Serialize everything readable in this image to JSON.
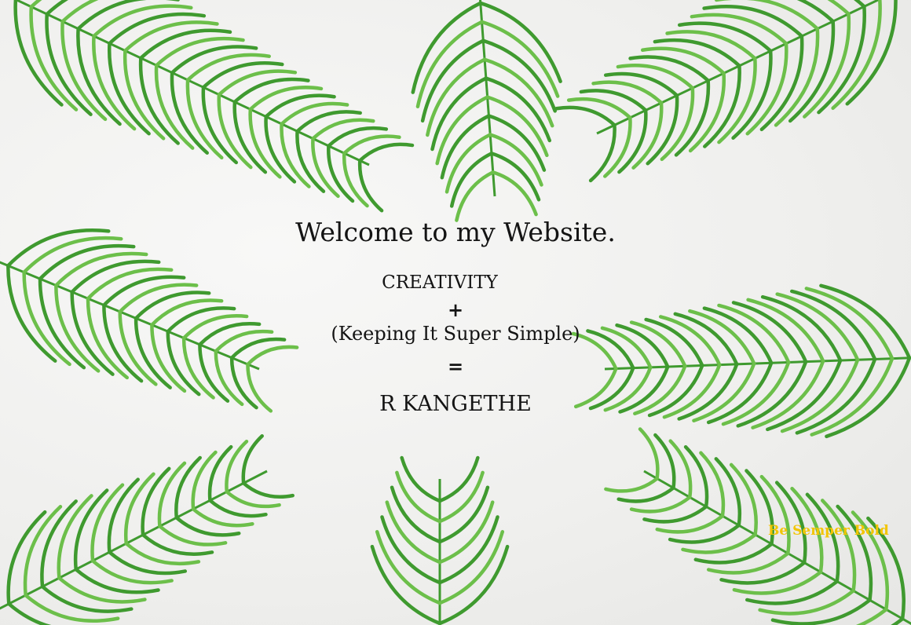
{
  "hero": {
    "welcome": "Welcome to my Website.",
    "line1": "CREATIVITY",
    "plus": "+",
    "line2": "(Keeping It Super Simple)",
    "equals": "=",
    "name": "R KANGETHE"
  },
  "slogan": "Be Semper Bold",
  "colors": {
    "background": "#efefed",
    "leaf": "#3f9a2f",
    "leaf_light": "#6cbf4a",
    "text": "#141414",
    "slogan": "#f2c500"
  },
  "background": {
    "description_icon": "palm-frond-icon"
  }
}
